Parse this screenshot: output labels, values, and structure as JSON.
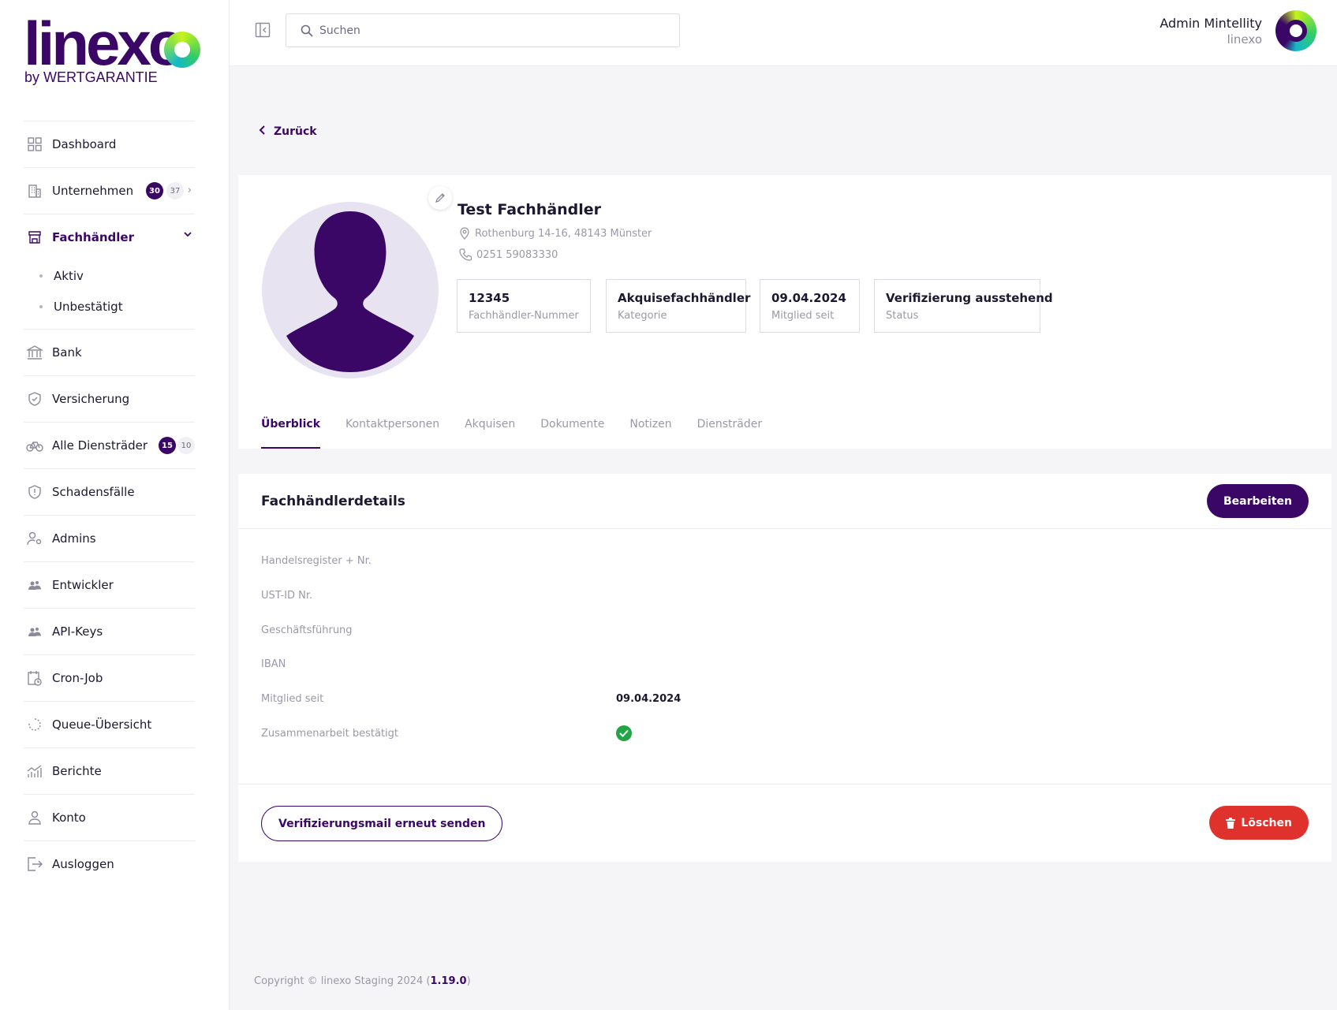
{
  "brand": {
    "logo_text": "linexo",
    "logo_sub": "by WERTGARANTIE",
    "accent": "#3b0767",
    "lime": "#c6f31b"
  },
  "sidebar": {
    "items": [
      {
        "label": "Dashboard",
        "icon": "grid-icon"
      },
      {
        "label": "Unternehmen",
        "icon": "building-icon",
        "badge_dark": "30",
        "badge_light": "37"
      },
      {
        "label": "Fachhändler",
        "icon": "store-icon",
        "active": true
      },
      {
        "label": "Bank",
        "icon": "bank-icon"
      },
      {
        "label": "Versicherung",
        "icon": "shield-icon"
      },
      {
        "label": "Alle Diensträder",
        "icon": "bike-icon",
        "badge_dark": "15",
        "badge_light": "10"
      },
      {
        "label": "Schadensfälle",
        "icon": "shield-alert-icon"
      },
      {
        "label": "Admins",
        "icon": "user-gear-icon"
      },
      {
        "label": "Entwickler",
        "icon": "users-icon"
      },
      {
        "label": "API-Keys",
        "icon": "users-icon"
      },
      {
        "label": "Cron-Job",
        "icon": "calendar-clock-icon"
      },
      {
        "label": "Queue-Übersicht",
        "icon": "spinner-icon"
      },
      {
        "label": "Berichte",
        "icon": "chart-icon"
      },
      {
        "label": "Konto",
        "icon": "user-icon"
      },
      {
        "label": "Ausloggen",
        "icon": "logout-icon"
      }
    ],
    "subitems": [
      {
        "label": "Aktiv"
      },
      {
        "label": "Unbestätigt"
      }
    ]
  },
  "header": {
    "search_placeholder": "Suchen",
    "user_name": "Admin Mintellity",
    "user_org": "linexo"
  },
  "back_label": "Zurück",
  "profile": {
    "name": "Test Fachhändler",
    "address": "Rothenburg 14-16, 48143 Münster",
    "phone": "0251 59083330",
    "stats": [
      {
        "value": "12345",
        "label": "Fachhändler-Nummer"
      },
      {
        "value": "Akquisefachhändler",
        "label": "Kategorie"
      },
      {
        "value": "09.04.2024",
        "label": "Mitglied seit"
      },
      {
        "value": "Verifizierung ausstehend",
        "label": "Status"
      }
    ]
  },
  "tabs": [
    {
      "label": "Überblick",
      "active": true
    },
    {
      "label": "Kontaktpersonen"
    },
    {
      "label": "Akquisen"
    },
    {
      "label": "Dokumente"
    },
    {
      "label": "Notizen"
    },
    {
      "label": "Diensträder"
    }
  ],
  "details": {
    "title": "Fachhändlerdetails",
    "edit_label": "Bearbeiten",
    "rows": [
      {
        "label": "Handelsregister + Nr.",
        "value": ""
      },
      {
        "label": "UST-ID Nr.",
        "value": ""
      },
      {
        "label": "Geschäftsführung",
        "value": ""
      },
      {
        "label": "IBAN",
        "value": ""
      },
      {
        "label": "Mitglied seit",
        "value": "09.04.2024"
      },
      {
        "label": "Zusammenarbeit bestätigt",
        "value": "",
        "check": true
      }
    ],
    "resend_label": "Verifizierungsmail erneut senden",
    "delete_label": "Löschen"
  },
  "footer": {
    "prefix": "Copyright © linexo Staging 2024 (",
    "version": "1.19.0",
    "suffix": ")"
  }
}
